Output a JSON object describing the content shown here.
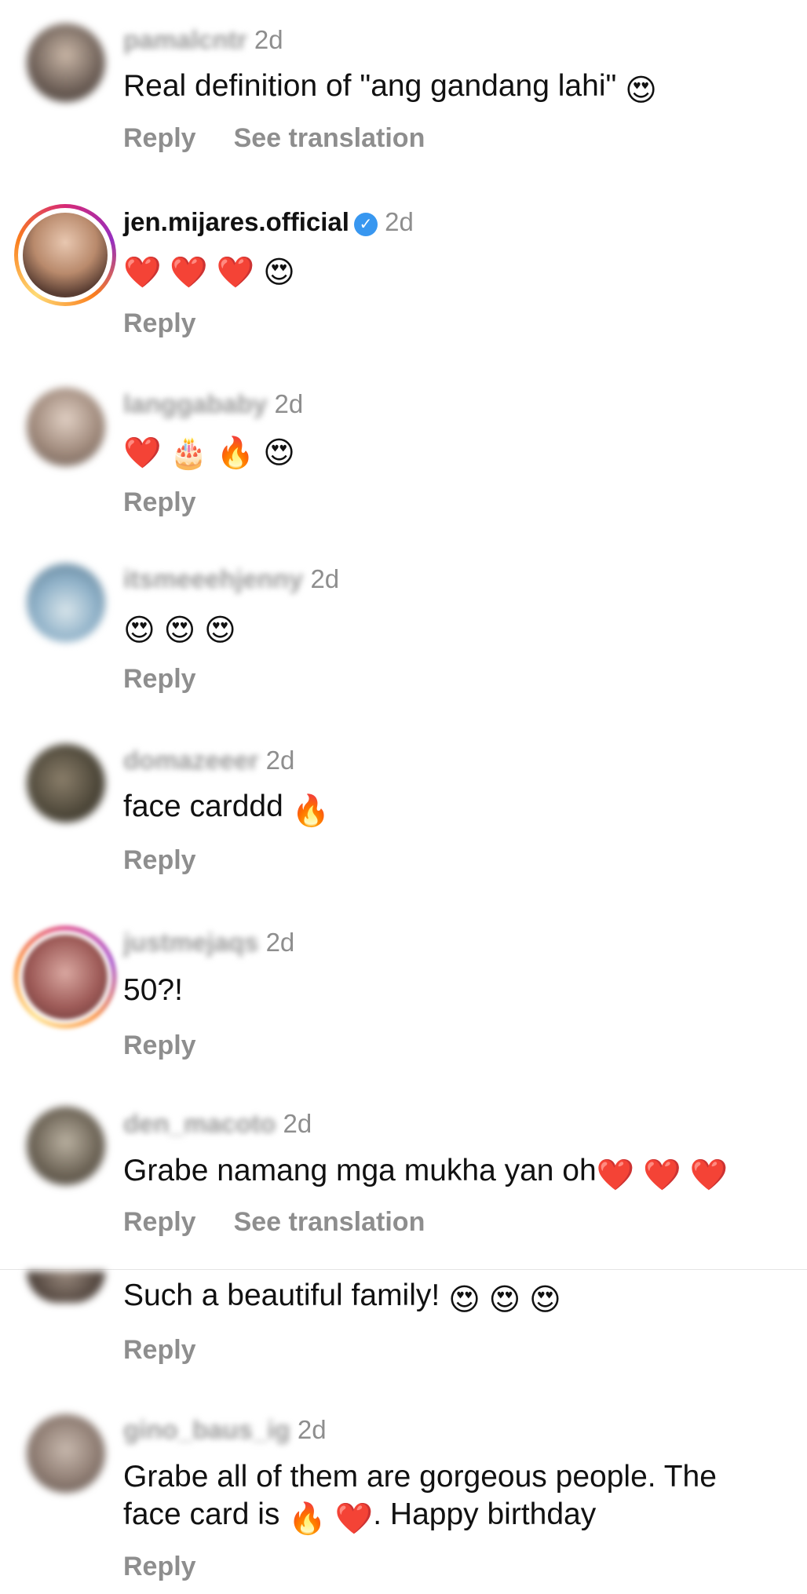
{
  "comments": [
    {
      "username": "pamalcntr",
      "time": "2d",
      "text": "Real definition of \"ang gandang lahi\"",
      "emoji": "😍",
      "reply": "Reply",
      "translate": "See translation"
    },
    {
      "username": "jen.mijares.official",
      "time": "2d",
      "text": "",
      "emoji": "❤️ ❤️ ❤️ 😍",
      "reply": "Reply",
      "verified": true
    },
    {
      "username": "langgababy",
      "time": "2d",
      "text": "",
      "emoji": "❤️ 🎂 🔥 😍",
      "reply": "Reply"
    },
    {
      "username": "itsmeeehjenny",
      "time": "2d",
      "text": "",
      "emoji": "😍 😍 😍",
      "reply": "Reply"
    },
    {
      "username": "domazeeer",
      "time": "2d",
      "text": "face carddd",
      "emoji": "🔥",
      "reply": "Reply"
    },
    {
      "username": "justmejaqs",
      "time": "2d",
      "text": "50?!",
      "emoji": "",
      "reply": "Reply"
    },
    {
      "username": "den_macoto",
      "time": "2d",
      "text": "Grabe namang mga mukha yan oh",
      "emoji": "❤️ ❤️ ❤️",
      "reply": "Reply",
      "translate": "See translation"
    },
    {
      "username": "",
      "time": "",
      "text": "Such a beautiful family!",
      "emoji": "😍 😍 😍",
      "reply": "Reply"
    },
    {
      "username": "gino_baus_ig",
      "time": "2d",
      "text_line1": "Grabe all of them are gorgeous people. The",
      "text_line2_pre": "face card is",
      "text_line2_emoji": "🔥 ❤️",
      "text_line2_post": ". Happy birthday",
      "reply": "Reply"
    }
  ],
  "icons": {
    "verified": "verified-badge-icon"
  },
  "colors": {
    "secondary_text": "#8e8e8e",
    "verified_blue": "#3897f0"
  }
}
